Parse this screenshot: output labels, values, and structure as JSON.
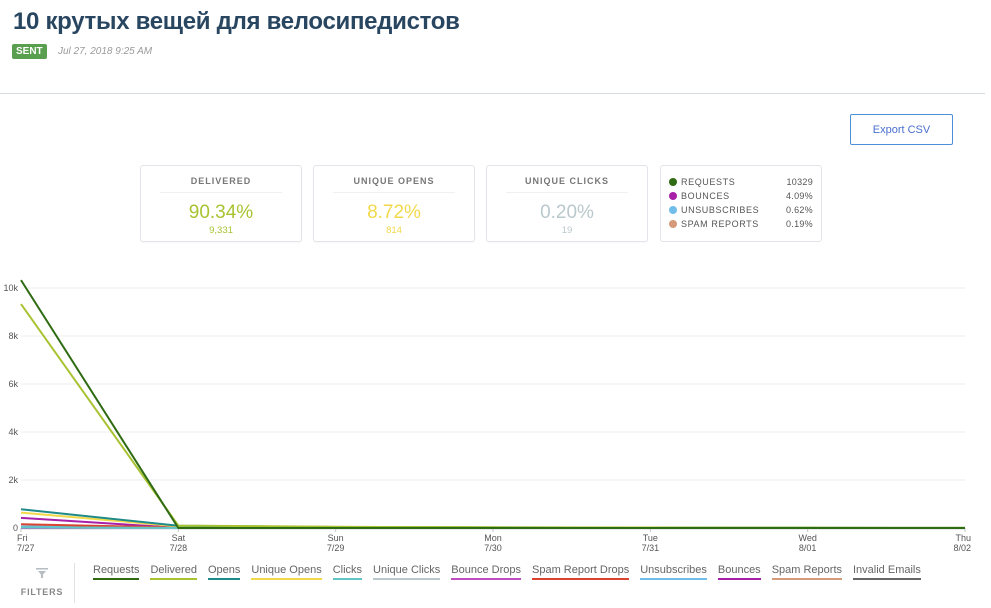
{
  "header": {
    "title": "10 крутых вещей для велосипедистов",
    "status_badge": "SENT",
    "sent_date": "Jul 27, 2018 9:25 AM"
  },
  "toolbar": {
    "export_label": "Export CSV"
  },
  "summary_cards": [
    {
      "label": "DELIVERED",
      "percent": "90.34%",
      "count": "9,331",
      "color": "#a8c332"
    },
    {
      "label": "UNIQUE OPENS",
      "percent": "8.72%",
      "count": "814",
      "color": "#f1d94a"
    },
    {
      "label": "UNIQUE CLICKS",
      "percent": "0.20%",
      "count": "19",
      "color": "#b9c8cc"
    }
  ],
  "stats": [
    {
      "label": "REQUESTS",
      "value": "10329",
      "color": "#2e6b12"
    },
    {
      "label": "BOUNCES",
      "value": "4.09%",
      "color": "#a81fa8"
    },
    {
      "label": "UNSUBSCRIBES",
      "value": "0.62%",
      "color": "#70bde9"
    },
    {
      "label": "SPAM REPORTS",
      "value": "0.19%",
      "color": "#d59a7a"
    }
  ],
  "filters_label": "FILTERS",
  "chart_data": {
    "type": "line",
    "title": "",
    "xlabel": "",
    "ylabel": "",
    "ylim": [
      0,
      10000
    ],
    "yticks": [
      0,
      2000,
      4000,
      6000,
      8000,
      10000
    ],
    "ytick_labels": [
      "0",
      "2k",
      "4k",
      "6k",
      "8k",
      "10k"
    ],
    "grid": true,
    "legend_position": "bottom",
    "x": [
      {
        "day": "Fri",
        "date": "7/27"
      },
      {
        "day": "Sat",
        "date": "7/28"
      },
      {
        "day": "Sun",
        "date": "7/29"
      },
      {
        "day": "Mon",
        "date": "7/30"
      },
      {
        "day": "Tue",
        "date": "7/31"
      },
      {
        "day": "Wed",
        "date": "8/01"
      },
      {
        "day": "Thu",
        "date": "8/02"
      }
    ],
    "series": [
      {
        "name": "Requests",
        "color": "#2e6b12",
        "values": [
          10329,
          0,
          0,
          0,
          0,
          0,
          0
        ]
      },
      {
        "name": "Delivered",
        "color": "#a8c332",
        "values": [
          9331,
          100,
          50,
          30,
          20,
          10,
          5
        ]
      },
      {
        "name": "Opens",
        "color": "#1f8a8a",
        "values": [
          780,
          90,
          40,
          25,
          15,
          10,
          5
        ]
      },
      {
        "name": "Unique Opens",
        "color": "#f1d94a",
        "values": [
          640,
          70,
          30,
          20,
          12,
          8,
          4
        ]
      },
      {
        "name": "Clicks",
        "color": "#5fc4c4",
        "values": [
          25,
          3,
          1,
          1,
          0,
          0,
          0
        ]
      },
      {
        "name": "Unique Clicks",
        "color": "#b9c8cc",
        "values": [
          19,
          2,
          1,
          0,
          0,
          0,
          0
        ]
      },
      {
        "name": "Bounce Drops",
        "color": "#c04ec0",
        "values": [
          0,
          0,
          0,
          0,
          0,
          0,
          0
        ]
      },
      {
        "name": "Spam Report Drops",
        "color": "#d9432f",
        "values": [
          160,
          20,
          10,
          5,
          3,
          2,
          1
        ]
      },
      {
        "name": "Unsubscribes",
        "color": "#70bde9",
        "values": [
          64,
          10,
          5,
          3,
          2,
          1,
          0
        ]
      },
      {
        "name": "Bounces",
        "color": "#a81fa8",
        "values": [
          422,
          10,
          5,
          2,
          1,
          0,
          0
        ]
      },
      {
        "name": "Spam Reports",
        "color": "#d59a7a",
        "values": [
          20,
          3,
          1,
          1,
          0,
          0,
          0
        ]
      },
      {
        "name": "Invalid Emails",
        "color": "#666666",
        "values": [
          60,
          5,
          2,
          1,
          0,
          0,
          0
        ]
      }
    ]
  }
}
